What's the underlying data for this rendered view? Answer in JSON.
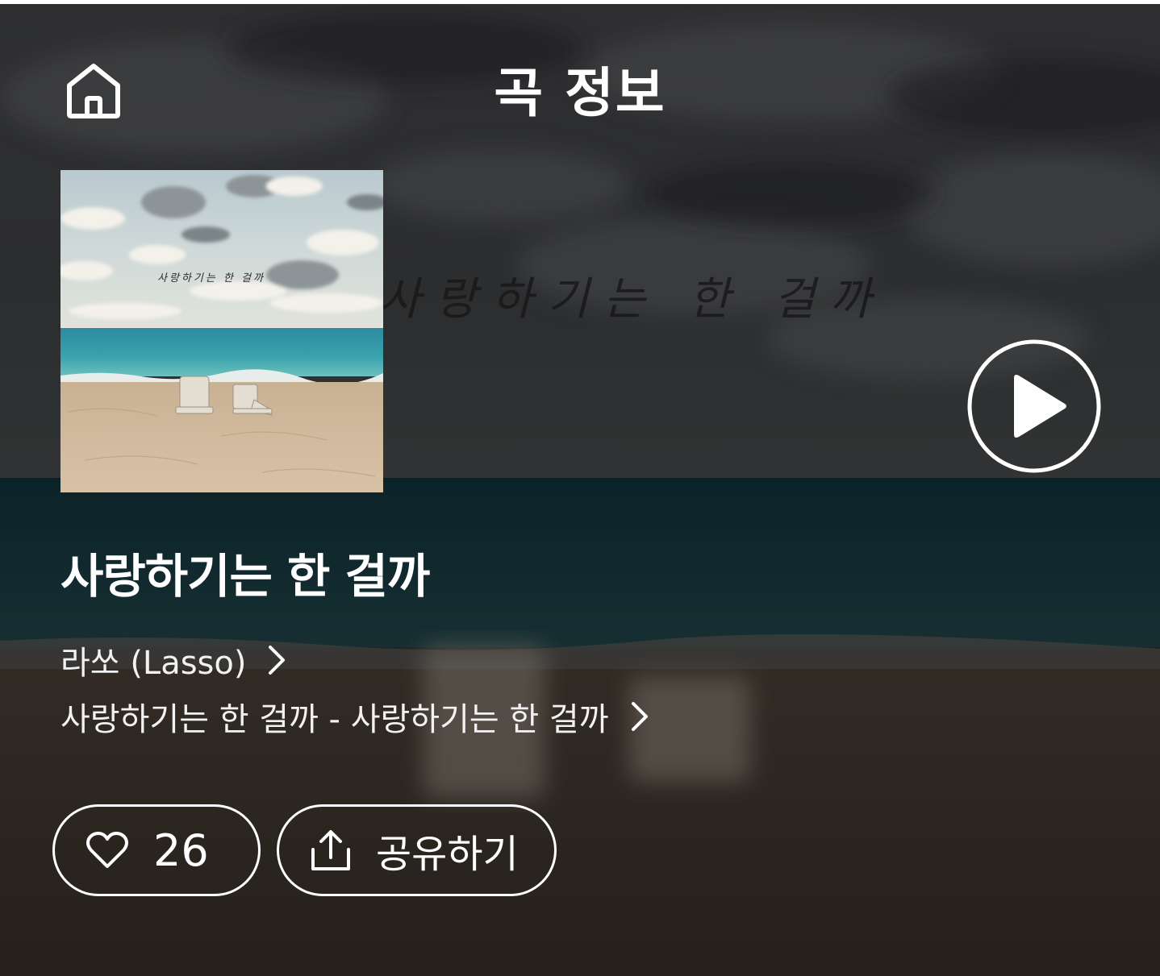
{
  "header": {
    "title": "곡 정보",
    "home_icon": "home-icon"
  },
  "album_art": {
    "cover_text": "사랑하기는 한 걸까",
    "background_text": "사랑하기는 한 걸까"
  },
  "song": {
    "title": "사랑하기는 한 걸까",
    "artist": "라쏘 (Lasso)",
    "album": "사랑하기는 한 걸까 - 사랑하기는 한 걸까"
  },
  "actions": {
    "like_count": "26",
    "like_icon": "heart-icon",
    "share_label": "공유하기",
    "share_icon": "share-icon",
    "play_icon": "play-icon"
  },
  "colors": {
    "text": "#ffffff",
    "sky_dark": "#2f3034",
    "sea_dark": "#0e2c33",
    "sand_dark": "#3b3129"
  }
}
